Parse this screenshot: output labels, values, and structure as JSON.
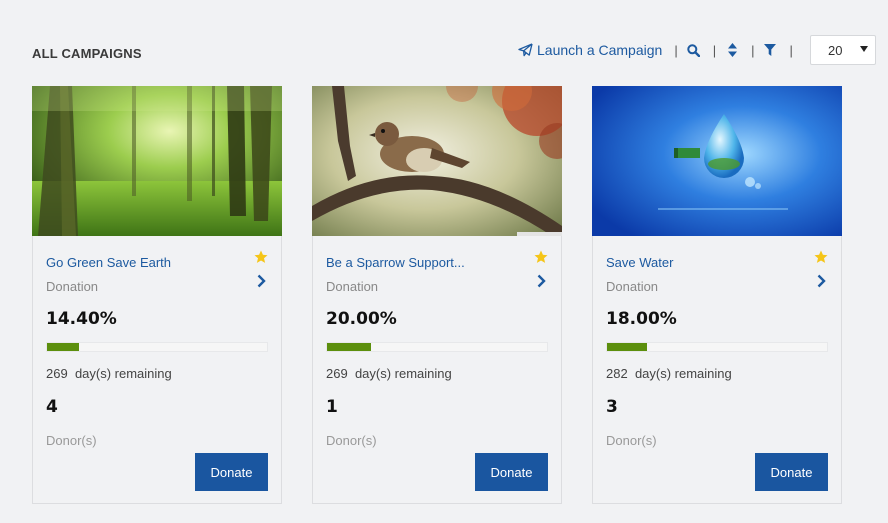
{
  "page": {
    "title": "ALL CAMPAIGNS"
  },
  "toolbar": {
    "launch_label": "Launch a Campaign",
    "separator": "|",
    "per_page_value": "20",
    "icons": [
      "paper-plane-icon",
      "search-icon",
      "sort-icon",
      "filter-icon",
      "caret-down-icon"
    ]
  },
  "colors": {
    "link": "#1d5aa0",
    "button": "#1a56a0",
    "progress": "#5c8f0d",
    "star": "#f5c518"
  },
  "campaigns": [
    {
      "title": "Go Green Save Earth",
      "type": "Donation",
      "percent": "14.40%",
      "progress": 14.4,
      "days_number": "269",
      "days_remaining": "day(s) remaining",
      "donors": "4",
      "donor_label": "Donor(s)",
      "donate_label": "Donate"
    },
    {
      "title": "Be a Sparrow Support...",
      "type": "Donation",
      "percent": "20.00%",
      "progress": 20.0,
      "days_number": "269",
      "days_remaining": "day(s) remaining",
      "donors": "1",
      "donor_label": "Donor(s)",
      "donate_label": "Donate"
    },
    {
      "title": "Save Water",
      "type": "Donation",
      "percent": "18.00%",
      "progress": 18.0,
      "days_number": "282",
      "days_remaining": "day(s) remaining",
      "donors": "3",
      "donor_label": "Donor(s)",
      "donate_label": "Donate"
    }
  ]
}
